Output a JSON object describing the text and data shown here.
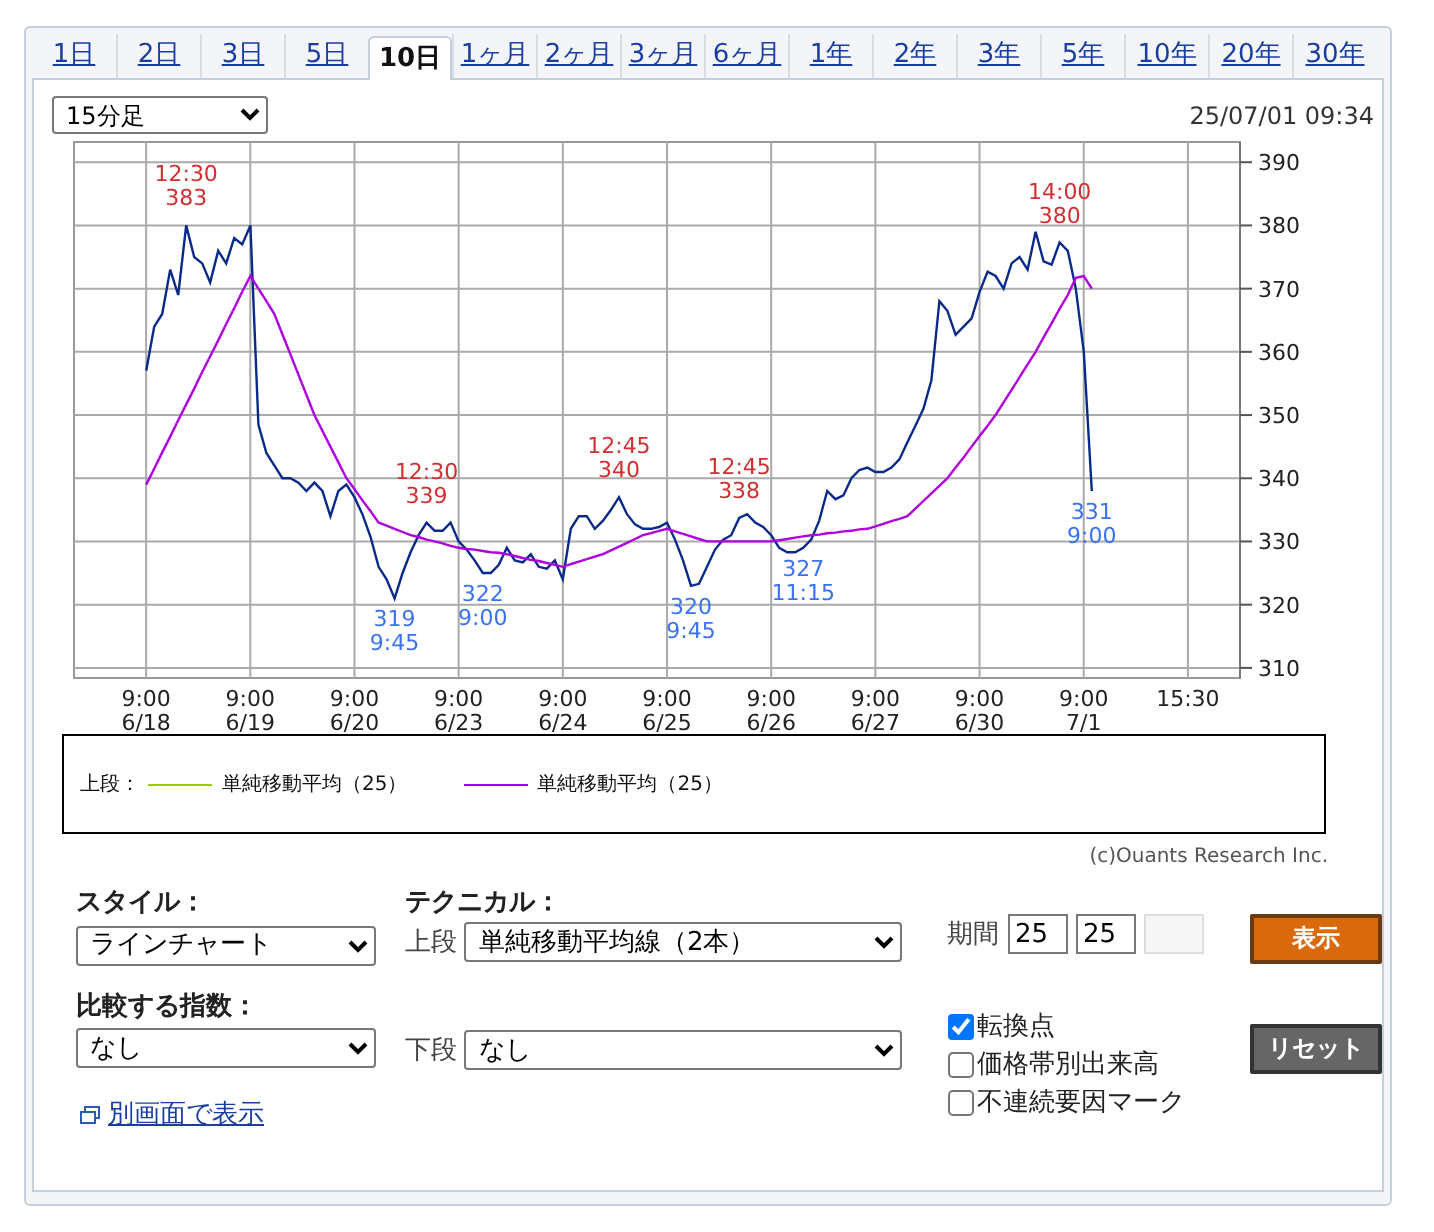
{
  "tabs": [
    {
      "label": "1日",
      "selected": false
    },
    {
      "label": "2日",
      "selected": false
    },
    {
      "label": "3日",
      "selected": false
    },
    {
      "label": "5日",
      "selected": false
    },
    {
      "label": "10日",
      "selected": true
    },
    {
      "label": "1ヶ月",
      "selected": false
    },
    {
      "label": "2ヶ月",
      "selected": false
    },
    {
      "label": "3ヶ月",
      "selected": false
    },
    {
      "label": "6ヶ月",
      "selected": false
    },
    {
      "label": "1年",
      "selected": false
    },
    {
      "label": "2年",
      "selected": false
    },
    {
      "label": "3年",
      "selected": false
    },
    {
      "label": "5年",
      "selected": false
    },
    {
      "label": "10年",
      "selected": false
    },
    {
      "label": "20年",
      "selected": false
    },
    {
      "label": "30年",
      "selected": false
    }
  ],
  "chart_panel": {
    "interval_select": "15分足",
    "timestamp": "25/07/01 09:34",
    "chart_data": {
      "type": "line",
      "categories": [
        "9:00 6/18",
        null,
        null,
        null,
        null,
        null,
        null,
        null,
        null,
        null,
        null,
        null,
        null,
        "9:00 6/19",
        null,
        null,
        null,
        null,
        null,
        null,
        null,
        null,
        null,
        null,
        null,
        null,
        "9:00 6/20",
        null,
        null,
        null,
        null,
        null,
        null,
        null,
        null,
        null,
        null,
        null,
        null,
        "9:00 6/23",
        null,
        null,
        null,
        null,
        null,
        null,
        null,
        null,
        null,
        null,
        null,
        null,
        "9:00 6/24",
        null,
        null,
        null,
        null,
        null,
        null,
        null,
        null,
        null,
        null,
        null,
        null,
        "9:00 6/25",
        null,
        null,
        null,
        null,
        null,
        null,
        null,
        null,
        null,
        null,
        null,
        null,
        "9:00 6/26",
        null,
        null,
        null,
        null,
        null,
        null,
        null,
        null,
        null,
        null,
        null,
        null,
        "9:00 6/27",
        null,
        null,
        null,
        null,
        null,
        null,
        null,
        null,
        null,
        null,
        null,
        null,
        "9:00 6/30",
        null,
        null,
        null,
        null,
        null,
        null,
        null,
        null,
        null,
        null,
        null,
        null,
        "9:00 7/1",
        null,
        null,
        null,
        null,
        null,
        null,
        null,
        null,
        null,
        null,
        null,
        null,
        "15:30"
      ],
      "series": [
        {
          "color": "#0a2a8a",
          "values": [
            357,
            364,
            366,
            373,
            369,
            380,
            375,
            374,
            371,
            376,
            374,
            378,
            377,
            380,
            348.5,
            344,
            342,
            340,
            340,
            339.3,
            338,
            339.3,
            338,
            334,
            338,
            339,
            337,
            334.3,
            330.7,
            326,
            324,
            321,
            325,
            328.3,
            331,
            333,
            331.7,
            331.7,
            333,
            330,
            328.7,
            327,
            325,
            325,
            326.3,
            329,
            327,
            326.7,
            328,
            326,
            325.7,
            327,
            324,
            332,
            334,
            334,
            332,
            333.3,
            335,
            337,
            334.3,
            332.7,
            332,
            332,
            332.3,
            333,
            330.3,
            327,
            323,
            323.3,
            326,
            328.7,
            330.3,
            331,
            333.7,
            334.3,
            333,
            332.3,
            331,
            329,
            328.3,
            328.3,
            329,
            330.3,
            333.3,
            338,
            336.7,
            337.3,
            340,
            341.3,
            341.7,
            341,
            341,
            341.7,
            343,
            345.7,
            348.3,
            351,
            355.5,
            368,
            366.5,
            362.7,
            364,
            365.3,
            369.5,
            372.7,
            372,
            370,
            374,
            375,
            373,
            379,
            374.3,
            373.8,
            377.3,
            376,
            370,
            360,
            338,
            null,
            null,
            null,
            null,
            null,
            null,
            null,
            null,
            null,
            null,
            null,
            null
          ]
        },
        {
          "color": "#b000e0",
          "values": [
            339,
            341.5,
            344.1,
            346.6,
            349.2,
            351.7,
            354.2,
            356.8,
            359.3,
            361.8,
            364.4,
            366.9,
            369.5,
            372,
            370,
            368,
            366,
            362.8,
            359.6,
            356.4,
            353.2,
            350,
            347.5,
            345,
            342.5,
            340,
            338.3,
            336.5,
            334.8,
            333,
            332.5,
            332,
            331.5,
            331,
            330.7,
            330.3,
            330,
            329.7,
            329.3,
            329,
            328.8,
            328.7,
            328.5,
            328.3,
            328.2,
            328,
            327.7,
            327.4,
            327.1,
            326.9,
            326.6,
            326.3,
            326,
            326.4,
            326.8,
            327.2,
            327.6,
            328,
            328.6,
            329.2,
            329.8,
            330.4,
            331,
            331.3,
            331.7,
            332,
            331.6,
            331.2,
            330.8,
            330.4,
            330,
            330,
            330,
            330,
            330,
            330,
            330,
            330,
            330,
            330.2,
            330.4,
            330.6,
            330.8,
            331,
            331.1,
            331.3,
            331.4,
            331.6,
            331.7,
            331.9,
            332,
            332.4,
            332.8,
            333.2,
            333.6,
            334,
            335.2,
            336.4,
            337.6,
            338.8,
            340,
            341.7,
            343.3,
            345,
            346.7,
            348.3,
            350,
            352,
            354,
            356,
            358,
            360,
            362.3,
            364.5,
            366.8,
            369,
            371.7,
            372,
            370,
            null,
            null,
            null,
            null,
            null,
            null,
            null,
            null,
            null,
            null,
            null,
            null
          ]
        }
      ],
      "grid": true,
      "ylim": [
        308.4,
        393.2
      ],
      "yticks": [
        310,
        320,
        330,
        340,
        350,
        360,
        370,
        380,
        390
      ]
    },
    "price_marks": [
      {
        "kind": "high",
        "text": "12:30\n383"
      },
      {
        "kind": "high",
        "text": "12:30\n339"
      },
      {
        "kind": "high",
        "text": "12:45\n340"
      },
      {
        "kind": "high",
        "text": "12:45\n338"
      },
      {
        "kind": "high",
        "text": "14:00\n380"
      },
      {
        "kind": "low",
        "text": "319\n9:45"
      },
      {
        "kind": "low",
        "text": "322\n9:00"
      },
      {
        "kind": "low",
        "text": "320\n9:45"
      },
      {
        "kind": "low",
        "text": "327\n11:15"
      },
      {
        "kind": "low",
        "text": "331\n9:00"
      }
    ],
    "legend": {
      "label": "上段：",
      "items": [
        {
          "name": "単純移動平均（25）",
          "color": "#99cc00"
        },
        {
          "name": "単純移動平均（25）",
          "color": "#9900ff"
        }
      ]
    },
    "copyright": "(c)Ouants Research Inc."
  },
  "controls": {
    "style_label": "スタイル：",
    "style_select": "ラインチャート",
    "technical_label": "テクニカル：",
    "upper_label": "上段",
    "upper_select": "単純移動平均線（2本）",
    "period_label": "期間",
    "period_inputs": [
      "25",
      "25"
    ],
    "show_button": "表示",
    "compare_label": "比較する指数：",
    "compare_select": "なし",
    "lower_label": "下段",
    "lower_select": "なし",
    "options": [
      {
        "label": "転換点",
        "checked": true
      },
      {
        "label": "価格帯別出来高",
        "checked": false
      },
      {
        "label": "不連続要因マーク",
        "checked": false
      }
    ],
    "reset_button": "リセット",
    "popup_link": "別画面で表示"
  }
}
